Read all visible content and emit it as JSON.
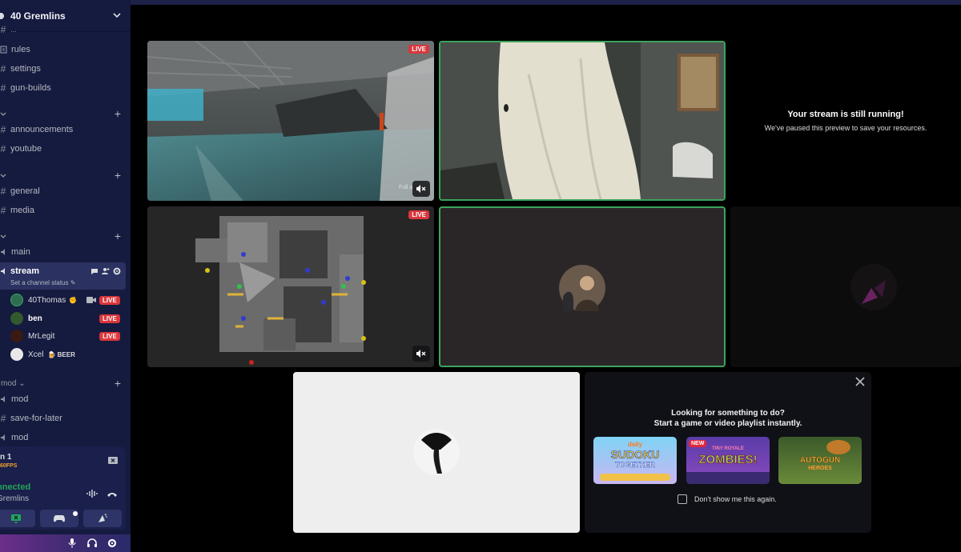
{
  "server": {
    "name": "40 Gremlins"
  },
  "channels": {
    "rules": "rules",
    "settings": "settings",
    "gun_builds": "gun-builds",
    "announcements": "announcements",
    "youtube": "youtube",
    "general": "general",
    "media": "media",
    "main": "main",
    "stream": "stream",
    "stream_status": "Set a channel status",
    "mod1": "mod",
    "save_for_later": "save-for-later",
    "mod2": "mod"
  },
  "categories": {
    "mod_label": "mod"
  },
  "voice_users": [
    {
      "name": "40Thomas",
      "live": "LIVE",
      "avatar_color": "#2f6d53"
    },
    {
      "name": "ben",
      "live": "LIVE",
      "avatar_color": "#335a2e"
    },
    {
      "name": "MrLegit",
      "live": "LIVE",
      "avatar_color": "#3b1a12"
    },
    {
      "name": "Xcel",
      "tag": "BEER",
      "avatar_color": "#e8e8e8"
    }
  ],
  "voice_panel": {
    "stream_label": "n 1",
    "fps": "60FPS",
    "status": "nnected",
    "server": "Gremlins"
  },
  "stage": {
    "live_label_1": "LIVE",
    "live_label_2": "LIVE",
    "fullscreen_hint": "Full a",
    "paused_title": "Your stream is still running!",
    "paused_sub": "We've paused this preview to save your resources."
  },
  "activity": {
    "title_line1": "Looking for something to do?",
    "title_line2": "Start a game or video playlist instantly.",
    "dont_show": "Don't show me this again.",
    "games": [
      {
        "name": "daily SUDOKU TOGETHER",
        "top": "daily",
        "main": "SUDOKU",
        "sub": "TOGETHER"
      },
      {
        "name": "ZOMBIES!",
        "badge": "NEW",
        "top": "TINY ROYALE",
        "main": "ZOMBIES!"
      },
      {
        "name": "AUTOGUN HEROES",
        "main": "AUTOGUN",
        "sub": "HEROES"
      }
    ]
  },
  "colors": {
    "sidebar_bg": "#151a3f",
    "live_red": "#da373c",
    "speaking_green": "#3ba55c",
    "connected_green": "#23a55a"
  }
}
